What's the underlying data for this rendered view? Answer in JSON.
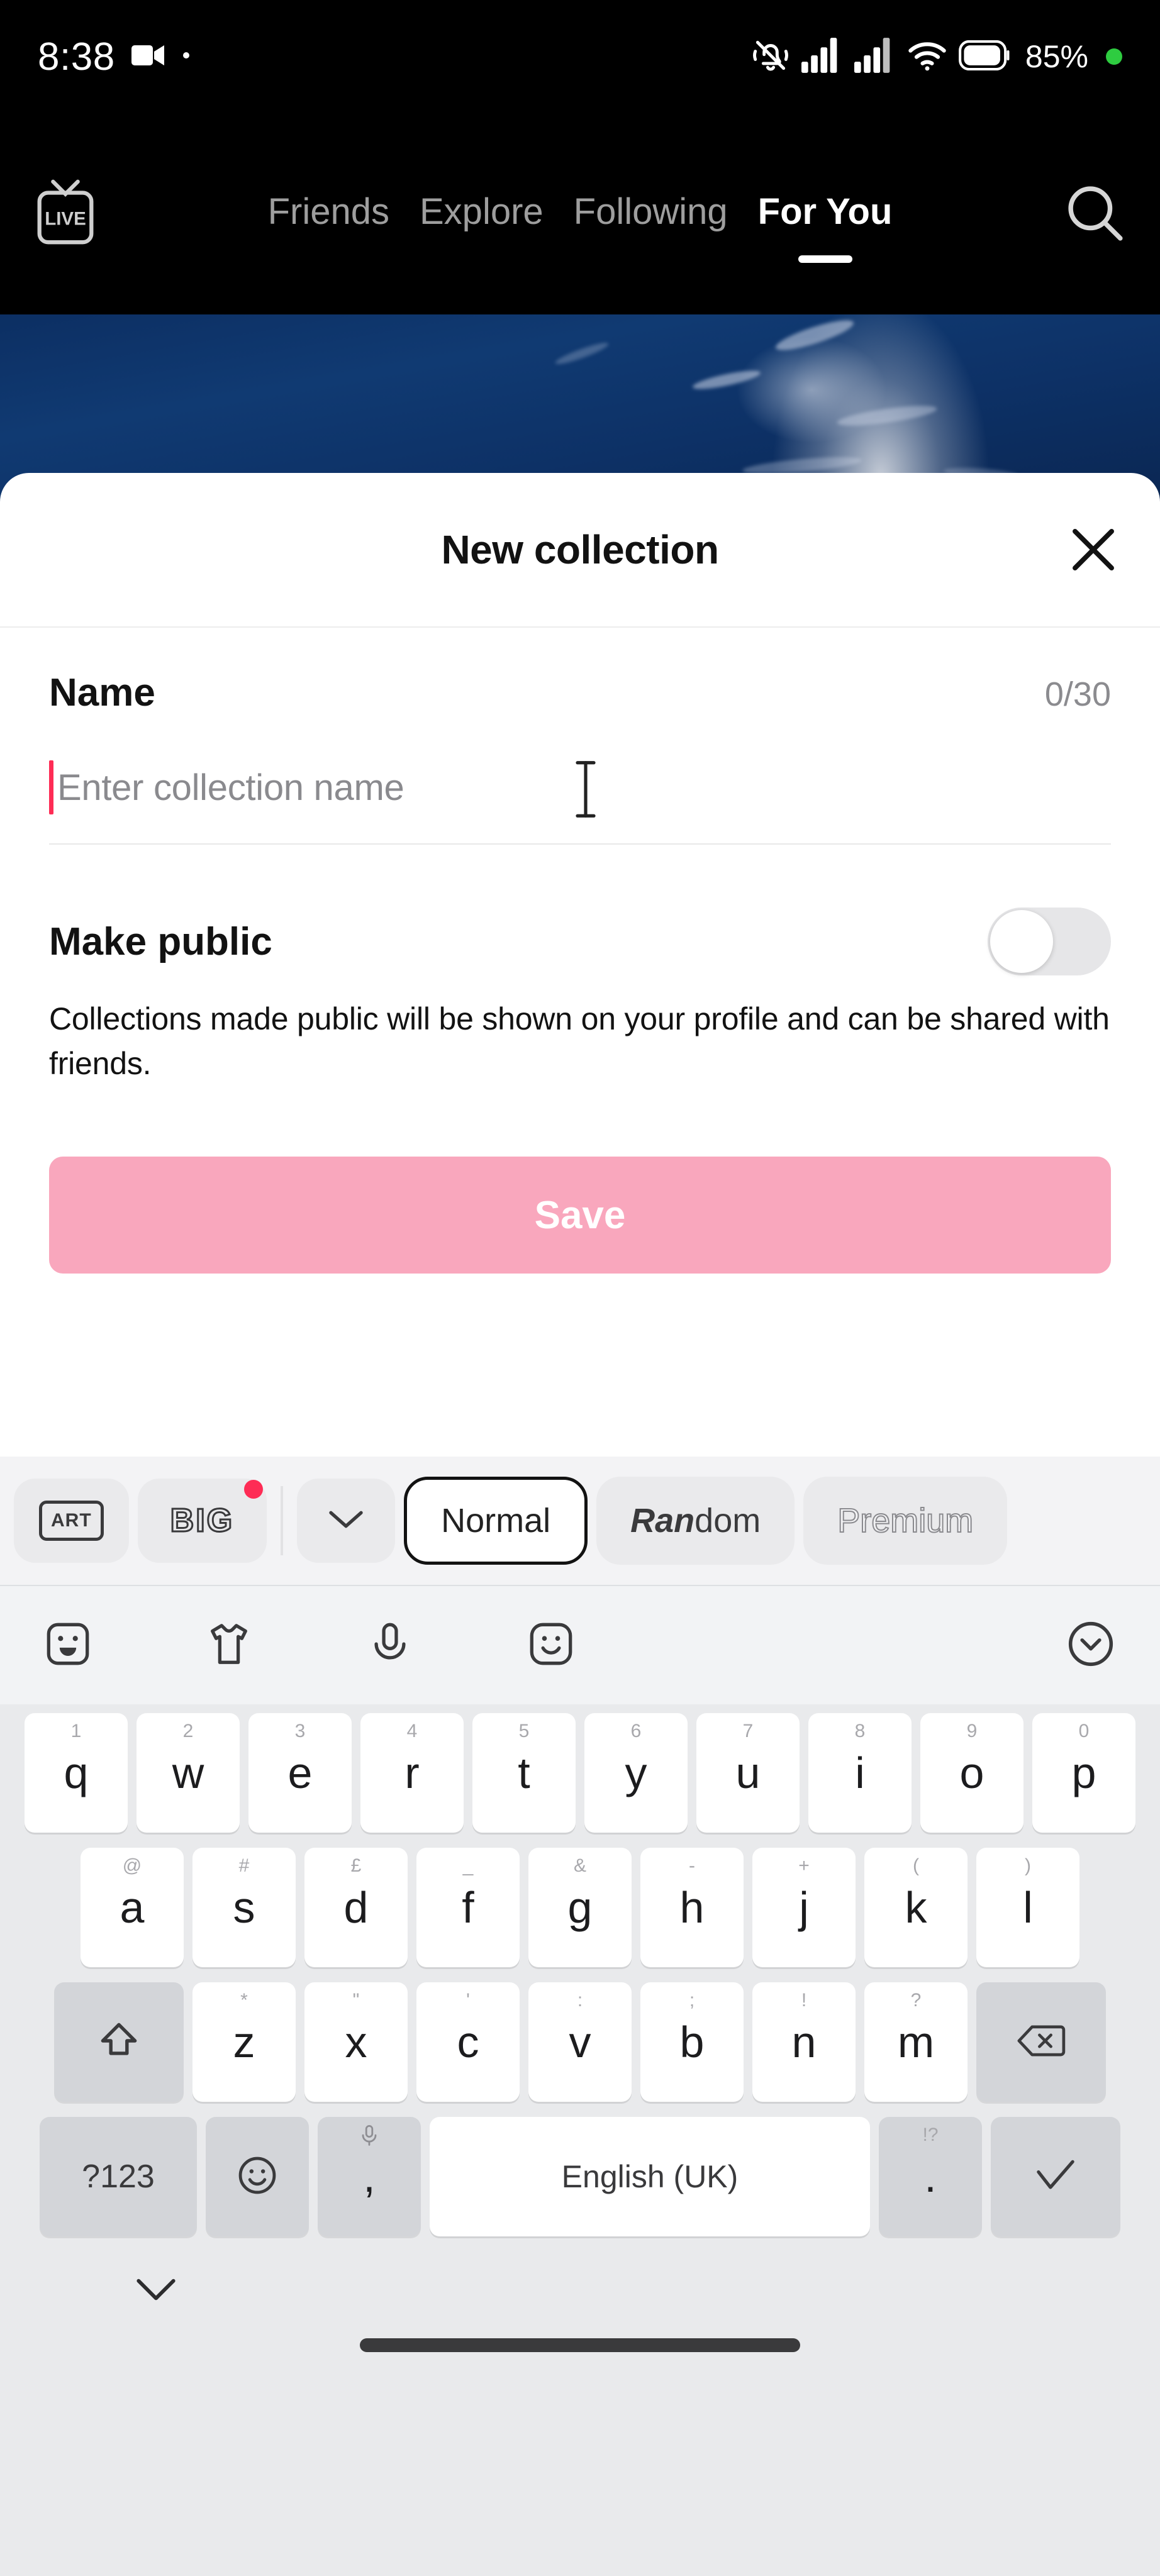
{
  "status_bar": {
    "time": "8:38",
    "battery_percent": "85%",
    "icons": [
      "video-recording-icon",
      "dot-indicator",
      "silent-mode-icon",
      "signal-bars-sim1-icon",
      "signal-bars-sim2-icon",
      "wifi-icon",
      "battery-icon",
      "green-recording-dot"
    ]
  },
  "top_nav": {
    "live_label": "LIVE",
    "tabs": [
      {
        "label": "Friends",
        "active": false
      },
      {
        "label": "Explore",
        "active": false
      },
      {
        "label": "Following",
        "active": false
      },
      {
        "label": "For You",
        "active": true
      }
    ],
    "search_icon": "search-icon"
  },
  "sheet": {
    "title": "New collection",
    "close_icon": "close-icon",
    "name_field": {
      "label": "Name",
      "counter": "0/30",
      "value": "",
      "placeholder": "Enter collection name"
    },
    "make_public": {
      "title": "Make public",
      "description": "Collections made public will be shown on your profile and can be shared with friends.",
      "enabled": false
    },
    "save_button": {
      "label": "Save",
      "enabled": false,
      "color": "#f9a7bd"
    }
  },
  "keyboard_toolbar": {
    "art_label": "ART",
    "big_label": "BIG",
    "big_has_badge": true,
    "chevron_icon": "chevron-down-icon",
    "styles": [
      {
        "label": "Normal",
        "selected": true
      },
      {
        "label": "Random",
        "selected": false
      },
      {
        "label": "Premium",
        "selected": false
      }
    ],
    "random_head": "Ran",
    "random_tail": "dom"
  },
  "keyboard": {
    "icon_row": [
      "sticker-icon",
      "tshirt-icon",
      "microphone-icon",
      "emoji-face-icon",
      "collapse-chevron-icon"
    ],
    "row1": [
      {
        "main": "q",
        "hint": "1"
      },
      {
        "main": "w",
        "hint": "2"
      },
      {
        "main": "e",
        "hint": "3"
      },
      {
        "main": "r",
        "hint": "4"
      },
      {
        "main": "t",
        "hint": "5"
      },
      {
        "main": "y",
        "hint": "6"
      },
      {
        "main": "u",
        "hint": "7"
      },
      {
        "main": "i",
        "hint": "8"
      },
      {
        "main": "o",
        "hint": "9"
      },
      {
        "main": "p",
        "hint": "0"
      }
    ],
    "row2": [
      {
        "main": "a",
        "hint": "@"
      },
      {
        "main": "s",
        "hint": "#"
      },
      {
        "main": "d",
        "hint": "£"
      },
      {
        "main": "f",
        "hint": "_"
      },
      {
        "main": "g",
        "hint": "&"
      },
      {
        "main": "h",
        "hint": "-"
      },
      {
        "main": "j",
        "hint": "+"
      },
      {
        "main": "k",
        "hint": "("
      },
      {
        "main": "l",
        "hint": ")"
      }
    ],
    "row3": [
      {
        "main": "z",
        "hint": "*"
      },
      {
        "main": "x",
        "hint": "\""
      },
      {
        "main": "c",
        "hint": "'"
      },
      {
        "main": "v",
        "hint": ":"
      },
      {
        "main": "b",
        "hint": ";"
      },
      {
        "main": "n",
        "hint": "!"
      },
      {
        "main": "m",
        "hint": "?"
      }
    ],
    "shift_icon": "shift-arrow-icon",
    "backspace_icon": "backspace-icon",
    "numbers_key": "?123",
    "emoji_key_icon": "emoji-smiley-icon",
    "comma_key": ",",
    "comma_hint_icon": "microphone-icon",
    "space_key": "English (UK)",
    "period_key": ".",
    "period_hint": "!?",
    "enter_icon": "checkmark-icon",
    "hide_keyboard_icon": "chevron-down-icon",
    "home_indicator": "home-gesture-bar"
  }
}
